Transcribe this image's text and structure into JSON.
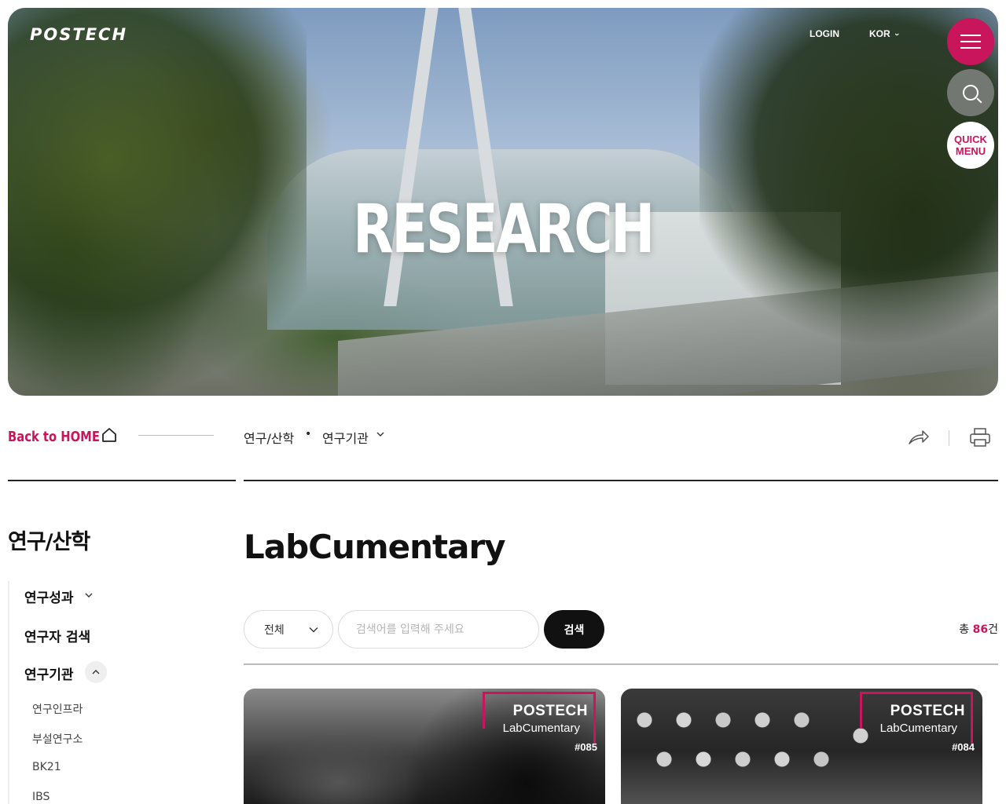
{
  "header": {
    "logo": "POSTECH",
    "login": "LOGIN",
    "lang": "KOR",
    "quick_menu_line1": "QUICK",
    "quick_menu_line2": "MENU",
    "hero_title": "RESEARCH"
  },
  "breadcrumb": {
    "back_home": "Back to HOME",
    "level1": "연구/산학",
    "separator": "•",
    "level2": "연구기관"
  },
  "sidebar": {
    "title": "연구/산학",
    "items": [
      {
        "label": "연구성과",
        "expanded": false
      },
      {
        "label": "연구자 검색"
      },
      {
        "label": "연구기관",
        "expanded": true
      }
    ],
    "sub_items": [
      "연구인프라",
      "부설연구소",
      "BK21",
      "IBS"
    ]
  },
  "main": {
    "title": "LabCumentary",
    "filter": {
      "selected": "전체",
      "search_placeholder": "검색어를 입력해 주세요",
      "search_value": "",
      "submit_label": "검색",
      "total_prefix": "총 ",
      "total_count": "86",
      "total_suffix": "건"
    },
    "cards": [
      {
        "brand": "POSTECH",
        "series": "LabCumentary",
        "number": "#085"
      },
      {
        "brand": "POSTECH",
        "series": "LabCumentary",
        "number": "#084"
      }
    ]
  },
  "colors": {
    "accent": "#c8155c",
    "dark": "#111111"
  }
}
